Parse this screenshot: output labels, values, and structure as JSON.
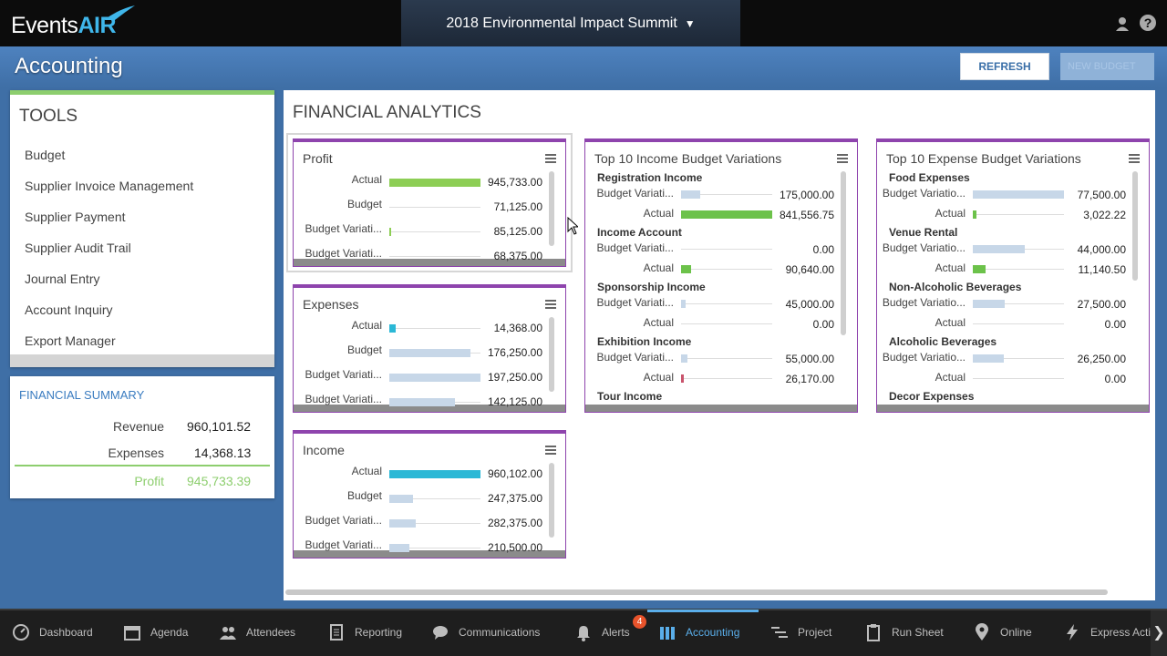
{
  "header": {
    "logo_events": "Events",
    "logo_air": "AIR",
    "event_name": "2018 Environmental Impact Summit"
  },
  "page": {
    "title": "Accounting",
    "refresh_label": "REFRESH",
    "ghost_label": "NEW BUDGET"
  },
  "tools": {
    "title": "TOOLS",
    "items": [
      "Budget",
      "Supplier Invoice Management",
      "Supplier Payment",
      "Supplier Audit Trail",
      "Journal Entry",
      "Account Inquiry",
      "Export Manager"
    ]
  },
  "summary": {
    "title": "FINANCIAL SUMMARY",
    "revenue_label": "Revenue",
    "revenue_value": "960,101.52",
    "expenses_label": "Expenses",
    "expenses_value": "14,368.13",
    "profit_label": "Profit",
    "profit_value": "945,733.39"
  },
  "analytics": {
    "title": "FINANCIAL ANALYTICS",
    "profit_card": {
      "title": "Profit",
      "rows": [
        {
          "label": "Actual",
          "value": "945,733.00",
          "fraction": 1.0,
          "color": "#8dce55"
        },
        {
          "label": "Budget",
          "value": "71,125.00",
          "fraction": 0.0,
          "color": "#c7d7e8"
        },
        {
          "label": "Budget Variati...",
          "value": "85,125.00",
          "fraction": 0.02,
          "color": "#8dce55"
        },
        {
          "label": "Budget Variati...",
          "value": "68,375.00",
          "fraction": 0.0,
          "color": "#c7d7e8"
        }
      ]
    },
    "expenses_card": {
      "title": "Expenses",
      "rows": [
        {
          "label": "Actual",
          "value": "14,368.00",
          "fraction": 0.07,
          "color": "#2bb8d6"
        },
        {
          "label": "Budget",
          "value": "176,250.00",
          "fraction": 0.89,
          "color": "#c7d7e8"
        },
        {
          "label": "Budget Variati...",
          "value": "197,250.00",
          "fraction": 1.0,
          "color": "#c7d7e8"
        },
        {
          "label": "Budget Variati...",
          "value": "142,125.00",
          "fraction": 0.72,
          "color": "#c7d7e8"
        }
      ]
    },
    "income_card": {
      "title": "Income",
      "rows": [
        {
          "label": "Actual",
          "value": "960,102.00",
          "fraction": 1.0,
          "color": "#2bb8d6"
        },
        {
          "label": "Budget",
          "value": "247,375.00",
          "fraction": 0.26,
          "color": "#c7d7e8"
        },
        {
          "label": "Budget Variati...",
          "value": "282,375.00",
          "fraction": 0.29,
          "color": "#c7d7e8"
        },
        {
          "label": "Budget Variati...",
          "value": "210,500.00",
          "fraction": 0.22,
          "color": "#c7d7e8"
        }
      ]
    },
    "income_variations": {
      "title": "Top 10 Income Budget Variations",
      "groups": [
        {
          "name": "Registration Income",
          "variation": "175,000.00",
          "var_fraction": 0.21,
          "actual": "841,556.75",
          "act_fraction": 1.0,
          "act_color": "#6cc24a"
        },
        {
          "name": "Income Account",
          "variation": "0.00",
          "var_fraction": 0.0,
          "actual": "90,640.00",
          "act_fraction": 0.11,
          "act_color": "#6cc24a"
        },
        {
          "name": "Sponsorship Income",
          "variation": "45,000.00",
          "var_fraction": 0.05,
          "actual": "0.00",
          "act_fraction": 0.0,
          "act_color": "#6cc24a"
        },
        {
          "name": "Exhibition Income",
          "variation": "55,000.00",
          "var_fraction": 0.07,
          "actual": "26,170.00",
          "act_fraction": 0.03,
          "act_color": "#c9546c"
        },
        {
          "name": "Tour Income",
          "variation": "",
          "var_fraction": 0.0,
          "actual": "",
          "act_fraction": 0.0,
          "act_color": "#6cc24a"
        }
      ]
    },
    "expense_variations": {
      "title": "Top 10 Expense Budget Variations",
      "groups": [
        {
          "name": "Food Expenses",
          "variation": "77,500.00",
          "var_fraction": 1.0,
          "actual": "3,022.22",
          "act_fraction": 0.04,
          "act_color": "#6cc24a"
        },
        {
          "name": "Venue Rental",
          "variation": "44,000.00",
          "var_fraction": 0.57,
          "actual": "11,140.50",
          "act_fraction": 0.14,
          "act_color": "#6cc24a"
        },
        {
          "name": "Non-Alcoholic Beverages",
          "variation": "27,500.00",
          "var_fraction": 0.35,
          "actual": "0.00",
          "act_fraction": 0.0,
          "act_color": "#6cc24a"
        },
        {
          "name": "Alcoholic Beverages",
          "variation": "26,250.00",
          "var_fraction": 0.34,
          "actual": "0.00",
          "act_fraction": 0.0,
          "act_color": "#6cc24a"
        },
        {
          "name": "Decor Expenses",
          "variation": "",
          "var_fraction": 0.0,
          "actual": "",
          "act_fraction": 0.0,
          "act_color": "#6cc24a"
        }
      ]
    },
    "variation_label": "Budget Variati...",
    "variation_label_exp": "Budget Variatio...",
    "actual_label": "Actual"
  },
  "nav": {
    "items": [
      {
        "label": "Dashboard",
        "icon": "dashboard-icon"
      },
      {
        "label": "Agenda",
        "icon": "calendar-icon"
      },
      {
        "label": "Attendees",
        "icon": "people-icon"
      },
      {
        "label": "Reporting",
        "icon": "document-icon"
      },
      {
        "label": "Communications",
        "icon": "chat-icon"
      },
      {
        "label": "Alerts",
        "icon": "bell-icon"
      },
      {
        "label": "Accounting",
        "icon": "accounting-icon"
      },
      {
        "label": "Project",
        "icon": "gantt-icon"
      },
      {
        "label": "Run Sheet",
        "icon": "clipboard-icon"
      },
      {
        "label": "Online",
        "icon": "location-pin-icon"
      },
      {
        "label": "Express Acti...",
        "icon": "lightning-icon"
      }
    ],
    "alert_count": "4",
    "active": "Accounting"
  },
  "colors": {
    "accent": "#8e44ad",
    "brand_blue": "#3fb6ea",
    "profit_green": "#8dce6e"
  }
}
